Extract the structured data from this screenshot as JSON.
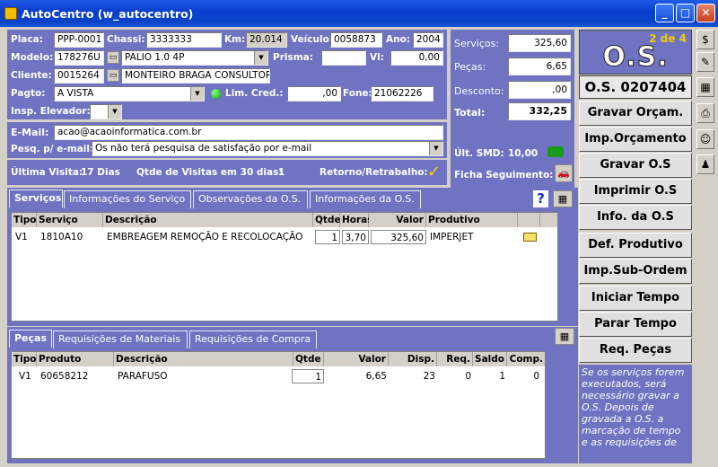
{
  "window": {
    "title": "AutoCentro (w_autocentro)",
    "min": "_",
    "max": "□",
    "close": "✕"
  },
  "vehicle": {
    "placa_label": "Placa:",
    "placa": "PPP-0001",
    "chassi_label": "Chassi:",
    "chassi": "3333333",
    "km_label": "Km:",
    "km": "20.014",
    "veiculo_label": "Veículo:",
    "veiculo": "0058873",
    "ano_label": "Ano:",
    "ano": "2004",
    "modelo_label": "Modelo:",
    "modelo_code": "178276U",
    "modelo_name": "PALIO 1.0 4P",
    "prisma_label": "Prisma:",
    "prisma": "",
    "vl_label": "Vl:",
    "vl": "0,00",
    "cliente_label": "Cliente:",
    "cliente_code": "0015264",
    "cliente_name": "MONTEIRO BRAGA CONSULTORIA",
    "pagto_label": "Pagto:",
    "pagto": "A VISTA",
    "limcred_label": "Lim. Cred.:",
    "limcred": ",00",
    "fone_label": "Fone:",
    "fone": "21062226",
    "insp_label": "Insp. Elevador:",
    "insp": ""
  },
  "email": {
    "label": "E-Mail:",
    "value": "acao@acaoinformatica.com.br",
    "pesq_label": "Pesq. p/ e-mail:",
    "pesq": "Os não terá pesquisa de satisfação por e-mail"
  },
  "visit": {
    "ultima_label": "Última Visita:",
    "ultima": "17 Dias",
    "qtde_label": "Qtde de Visitas em 30 dias:",
    "qtde": "1",
    "retorno_label": "Retorno/Retrabalho:"
  },
  "totals": {
    "servicos_label": "Serviços:",
    "servicos": "325,60",
    "pecas_label": "Peças:",
    "pecas": "6,65",
    "desconto_label": "Desconto:",
    "desconto": ",00",
    "total_label": "Total:",
    "total": "332,25",
    "smd_label": "Últ. SMD:",
    "smd": "10,00",
    "ficha_label": "Ficha  Seguimento:"
  },
  "os": {
    "counter": "2 de 4",
    "logo": "O.S.",
    "number": "O.S. 0207404"
  },
  "actions": [
    "Gravar Orçam.",
    "Imp.Orçamento",
    "Gravar O.S",
    "Imprimir O.S",
    "Info. da O.S",
    "Def. Produtivo",
    "Imp.Sub-Ordem",
    "Iniciar Tempo",
    "Parar Tempo",
    "Req. Peças"
  ],
  "info_text": "Se os serviços forem executados, será necessário gravar a O.S. Depois de gravada a O.S. a marcação de tempo e as requisições de",
  "service_tabs": [
    "Serviços",
    "Informações do Serviço",
    "Observações da O.S.",
    "Informações da O.S."
  ],
  "service_cols": [
    "Tipo",
    "Serviço",
    "Descrição",
    "Qtde",
    "Horas",
    "Valor",
    "Produtivo"
  ],
  "service_rows": [
    {
      "tipo": "V1",
      "servico": "1810A10",
      "descricao": "EMBREAGEM REMOÇÃO E RECOLOCAÇÃO",
      "qtde": "1",
      "horas": "3,70",
      "valor": "325,60",
      "produtivo": "IMPERJET"
    }
  ],
  "parts_tabs": [
    "Peças",
    "Requisições de Materiais",
    "Requisições de Compra"
  ],
  "parts_cols": [
    "Tipo",
    "Produto",
    "Descrição",
    "Qtde",
    "Valor",
    "Disp.",
    "Req.",
    "Saldo",
    "Comp."
  ],
  "parts_rows": [
    {
      "tipo": "V1",
      "produto": "60658212",
      "descricao": "PARAFUSO",
      "qtde": "1",
      "valor": "6,65",
      "disp": "23",
      "req": "0",
      "saldo": "1",
      "comp": "0"
    }
  ],
  "toolbar": [
    "$",
    "✎",
    "▦",
    "⎙",
    "☺",
    "♟"
  ],
  "colors": {
    "panel": "#6f73c2",
    "title": "#0a3fcf"
  }
}
